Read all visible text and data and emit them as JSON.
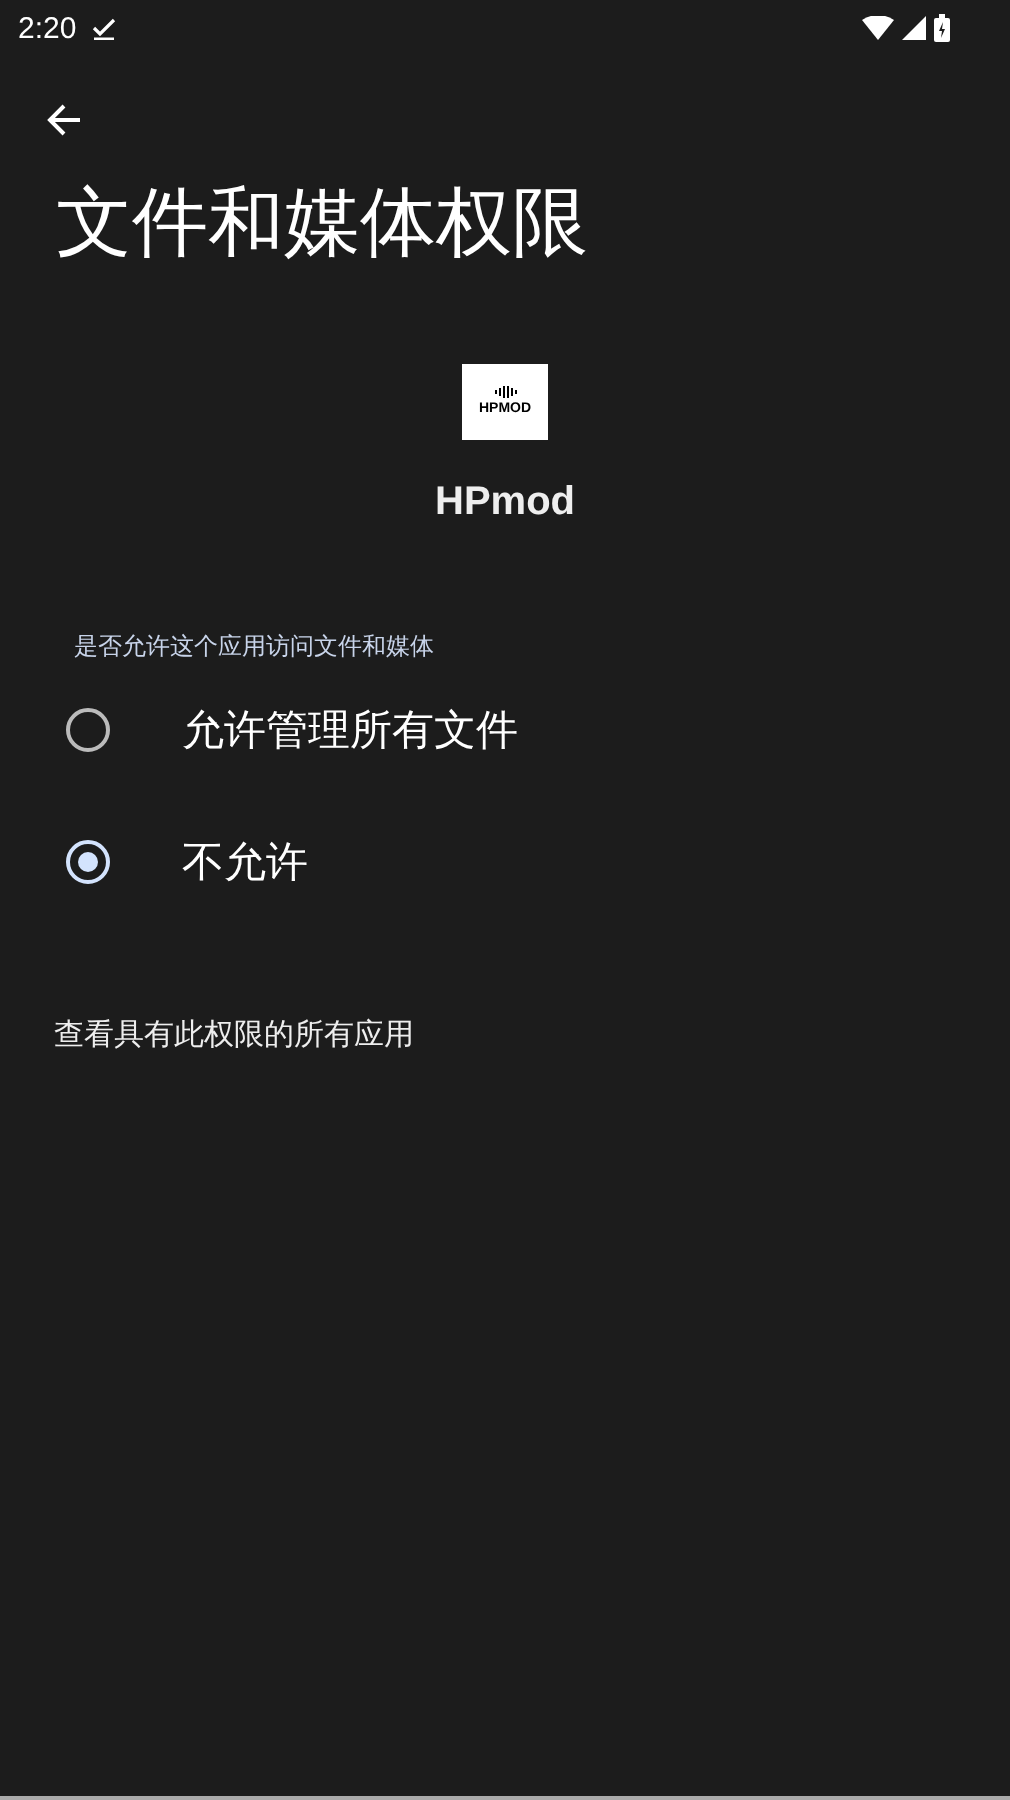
{
  "status_bar": {
    "time": "2:20"
  },
  "title": "文件和媒体权限",
  "app": {
    "logo_text": "HPMOD",
    "name": "HPmod"
  },
  "question": "是否允许这个应用访问文件和媒体",
  "options": [
    {
      "label": "允许管理所有文件",
      "selected": false
    },
    {
      "label": "不允许",
      "selected": true
    }
  ],
  "link": "查看具有此权限的所有应用"
}
